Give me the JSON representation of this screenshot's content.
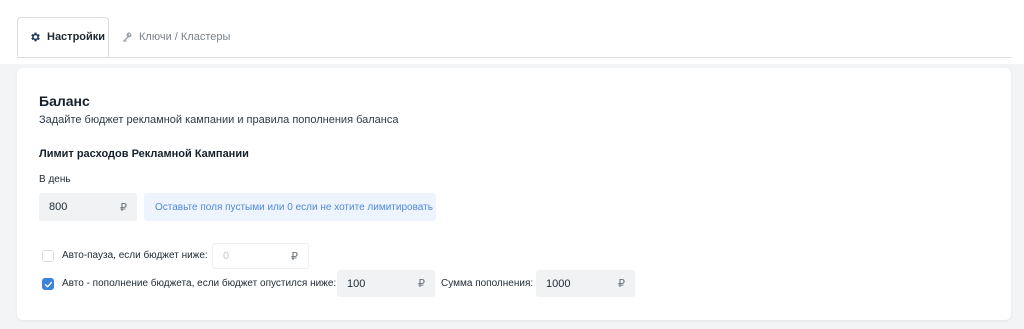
{
  "tabs": [
    {
      "label": "Настройки",
      "icon": "gear-icon",
      "active": true
    },
    {
      "label": "Ключи / Кластеры",
      "icon": "key-icon",
      "active": false
    }
  ],
  "balance": {
    "title": "Баланс",
    "subtitle": "Задайте бюджет рекламной кампании и правила пополнения баланса",
    "limit_title": "Лимит расходов Рекламной Кампании",
    "per_day_label": "В день",
    "daily_value": "800",
    "currency": "₽",
    "hint": "Оставьте поля пустыми или 0 если не хотите лимитировать"
  },
  "auto_pause": {
    "checked": false,
    "label": "Авто-пауза, если бюджет ниже:",
    "placeholder": "0",
    "currency": "₽"
  },
  "auto_topup": {
    "checked": true,
    "label": "Авто - пополнение бюджета, если бюджет опустился ниже:",
    "threshold": "100",
    "currency": "₽",
    "amount_label": "Сумма пополнения:",
    "amount": "1000"
  },
  "colors": {
    "accent": "#3b82d9",
    "hint_bg": "#eef4fd",
    "hint_text": "#4f8ad8"
  }
}
